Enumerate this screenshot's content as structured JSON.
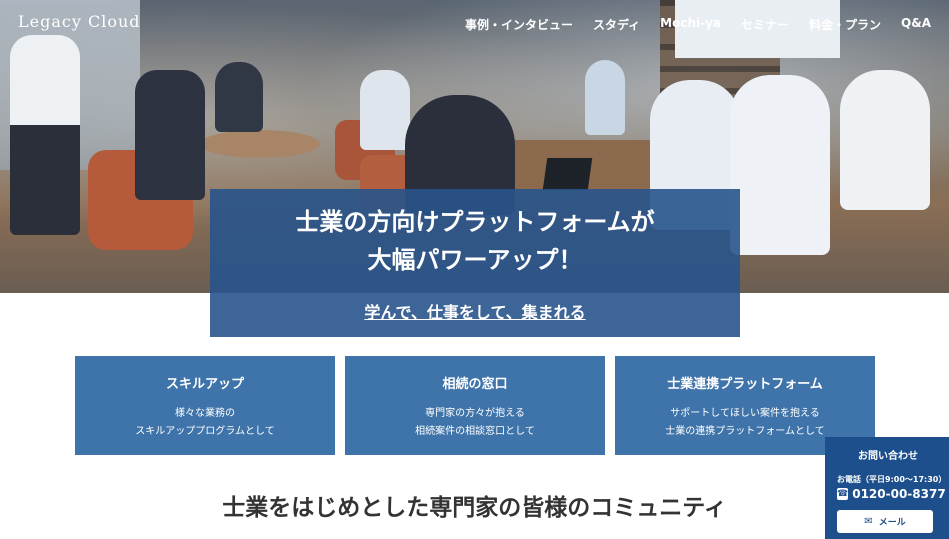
{
  "header": {
    "logo_text": "Legacy Cloud",
    "nav": [
      "事例・インタビュー",
      "スタディ",
      "Mochi-ya",
      "セミナー",
      "料金・プラン",
      "Q&A"
    ]
  },
  "hero": {
    "title_line1": "士業の方向けプラットフォームが",
    "title_line2": "大幅パワーアップ！",
    "subtitle": "学んで、仕事をして、集まれる"
  },
  "cards": [
    {
      "title": "スキルアップ",
      "desc_line1": "様々な業務の",
      "desc_line2": "スキルアッププログラムとして"
    },
    {
      "title": "相続の窓口",
      "desc_line1": "専門家の方々が抱える",
      "desc_line2": "相続案件の相談窓口として"
    },
    {
      "title": "士業連携プラットフォーム",
      "desc_line1": "サポートしてほしい案件を抱える",
      "desc_line2": "士業の連携プラットフォームとして"
    }
  ],
  "section": {
    "heading": "士業をはじめとした専門家の皆様のコミュニティ"
  },
  "contact": {
    "title": "お問い合わせ",
    "hours": "お電話（平日9:00～17:30）",
    "phone": "0120-00-8377",
    "mail_label": "メール",
    "phone_icon": "phone-icon",
    "mail_icon": "mail-icon"
  },
  "colors": {
    "primary_blue": "#3f74aa",
    "dark_blue": "#1d4f8d",
    "hero_overlay": "#28548c"
  }
}
